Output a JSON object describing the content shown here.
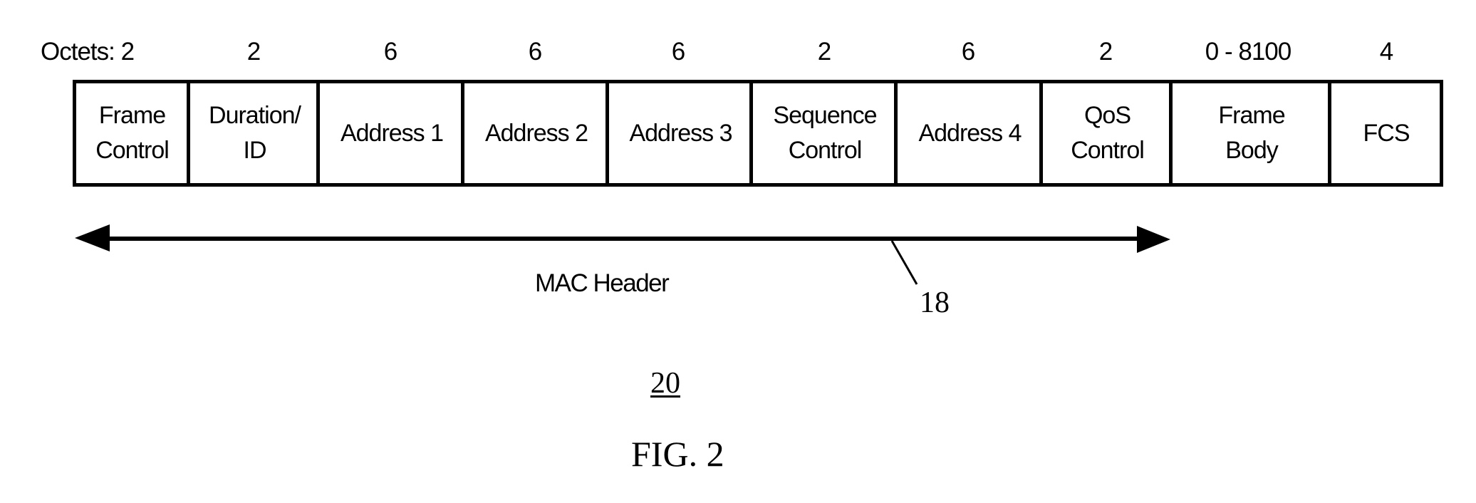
{
  "figure": {
    "title": "FIG. 2",
    "reference_numeral": "20"
  },
  "octets": {
    "prefix_label": "Octets: 2",
    "sizes": [
      "2",
      "2",
      "6",
      "6",
      "6",
      "2",
      "6",
      "2",
      "0 - 8100",
      "4"
    ]
  },
  "fields": [
    {
      "label": "Frame\nControl",
      "octets": "2"
    },
    {
      "label": "Duration/\nID",
      "octets": "2"
    },
    {
      "label": "Address 1",
      "octets": "6"
    },
    {
      "label": "Address 2",
      "octets": "6"
    },
    {
      "label": "Address 3",
      "octets": "6"
    },
    {
      "label": "Sequence\nControl",
      "octets": "2"
    },
    {
      "label": "Address 4",
      "octets": "6"
    },
    {
      "label": "QoS\nControl",
      "octets": "2"
    },
    {
      "label": "Frame\nBody",
      "octets": "0 - 8100"
    },
    {
      "label": "FCS",
      "octets": "4"
    }
  ],
  "mac_header": {
    "label": "MAC Header",
    "reference_numeral": "18",
    "spans_fields": [
      "Frame Control",
      "Duration/ID",
      "Address 1",
      "Address 2",
      "Address 3",
      "Sequence Control",
      "Address 4",
      "QoS Control"
    ]
  }
}
